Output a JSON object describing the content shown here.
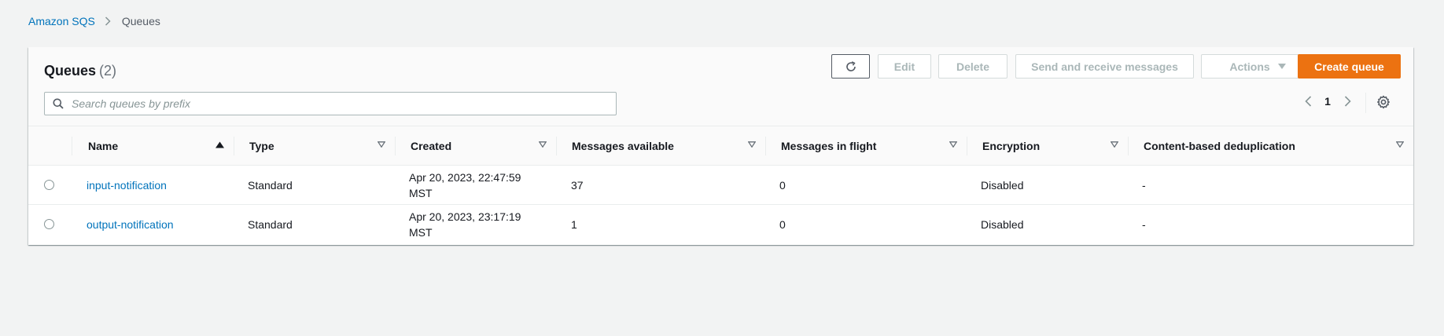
{
  "breadcrumb": {
    "root": "Amazon SQS",
    "current": "Queues"
  },
  "header": {
    "title": "Queues",
    "count": "(2)"
  },
  "toolbar": {
    "edit_label": "Edit",
    "delete_label": "Delete",
    "send_label": "Send and receive messages",
    "actions_label": "Actions",
    "create_label": "Create queue"
  },
  "search": {
    "placeholder": "Search queues by prefix",
    "value": ""
  },
  "pagination": {
    "current_page": "1"
  },
  "table": {
    "columns": [
      "Name",
      "Type",
      "Created",
      "Messages available",
      "Messages in flight",
      "Encryption",
      "Content-based deduplication"
    ],
    "rows": [
      {
        "name": "input-notification",
        "type": "Standard",
        "created_line1": "Apr 20, 2023, 22:47:59",
        "created_line2": "MST",
        "messages_available": "37",
        "messages_in_flight": "0",
        "encryption": "Disabled",
        "dedup": "-"
      },
      {
        "name": "output-notification",
        "type": "Standard",
        "created_line1": "Apr 20, 2023, 23:17:19",
        "created_line2": "MST",
        "messages_available": "1",
        "messages_in_flight": "0",
        "encryption": "Disabled",
        "dedup": "-"
      }
    ]
  },
  "colors": {
    "link": "#0073bb",
    "primary_button": "#ec7211",
    "background": "#f2f3f3"
  }
}
